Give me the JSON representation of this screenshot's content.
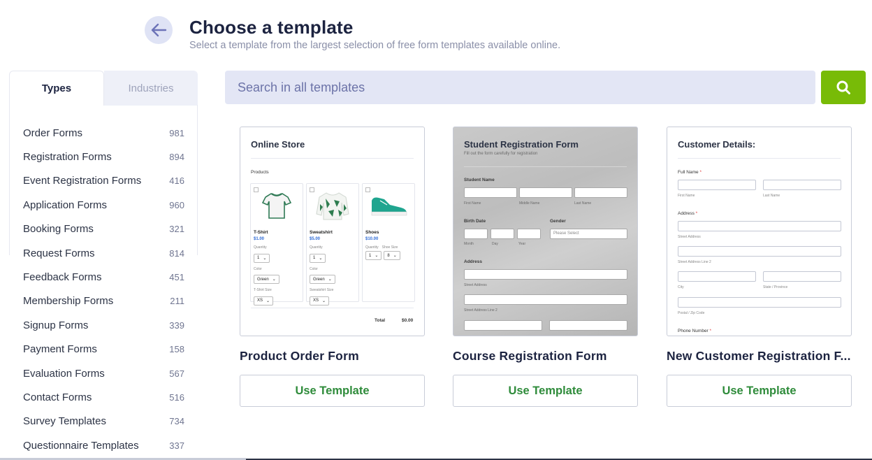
{
  "header": {
    "title": "Choose a template",
    "subtitle": "Select a template from the largest selection of free form templates available online."
  },
  "tabs": [
    {
      "label": "Types",
      "active": true
    },
    {
      "label": "Industries",
      "active": false
    }
  ],
  "types": [
    {
      "label": "Order Forms",
      "count": "981"
    },
    {
      "label": "Registration Forms",
      "count": "894"
    },
    {
      "label": "Event Registration Forms",
      "count": "416"
    },
    {
      "label": "Application Forms",
      "count": "960"
    },
    {
      "label": "Booking Forms",
      "count": "321"
    },
    {
      "label": "Request Forms",
      "count": "814"
    },
    {
      "label": "Feedback Forms",
      "count": "451"
    },
    {
      "label": "Membership Forms",
      "count": "211"
    },
    {
      "label": "Signup Forms",
      "count": "339"
    },
    {
      "label": "Payment Forms",
      "count": "158"
    },
    {
      "label": "Evaluation Forms",
      "count": "567"
    },
    {
      "label": "Contact Forms",
      "count": "516"
    },
    {
      "label": "Survey Templates",
      "count": "734"
    },
    {
      "label": "Questionnaire Templates",
      "count": "337"
    }
  ],
  "search": {
    "placeholder": "Search in all templates",
    "button_icon": "search-icon",
    "button_color": "#78bb07"
  },
  "accent": {
    "use_button_text": "#2e8b3a",
    "tab_inactive_bg": "#eef0f8"
  },
  "cards": [
    {
      "name": "Product Order Form",
      "button": "Use Template",
      "preview": {
        "title": "Online Store",
        "section": "Products",
        "products": [
          {
            "name": "T-Shirt",
            "price": "$1.00",
            "qty_label": "Quantity",
            "qty": "1",
            "color_label": "Color",
            "color": "Green",
            "size_label": "T-Shirt Size",
            "size": "XS"
          },
          {
            "name": "Sweatshirt",
            "price": "$5.00",
            "qty_label": "Quantity",
            "qty": "1",
            "color_label": "Color",
            "color": "Green",
            "size_label": "Sweatshirt Size",
            "size": "XS"
          },
          {
            "name": "Shoes",
            "price": "$10.00",
            "qty_label": "Quantity",
            "qty": "1",
            "shoe_size_label": "Shoe Size",
            "shoe_size": "8"
          }
        ],
        "total_label": "Total",
        "total": "$0.00"
      }
    },
    {
      "name": "Course Registration Form",
      "button": "Use Template",
      "preview": {
        "title": "Student Registration Form",
        "subtitle": "Fill out the form carefully for registration",
        "student_name": "Student Name",
        "first_name": "First Name",
        "middle_name": "Middle Name",
        "last_name": "Last Name",
        "birth_date": "Birth Date",
        "month": "Month",
        "day": "Day",
        "year": "Year",
        "gender": "Gender",
        "gender_placeholder": "Please Select",
        "address": "Address",
        "street": "Street Address",
        "street2": "Street Address Line 2"
      }
    },
    {
      "name": "New Customer Registration F...",
      "button": "Use Template",
      "preview": {
        "title": "Customer Details:",
        "full_name": "Full Name",
        "first_name": "First Name",
        "last_name": "Last Name",
        "address": "Address",
        "street": "Street Address",
        "street2": "Street Address Line 2",
        "city": "City",
        "state": "State / Province",
        "postal": "Postal / Zip Code",
        "phone": "Phone Number",
        "required_mark": "*"
      }
    }
  ]
}
